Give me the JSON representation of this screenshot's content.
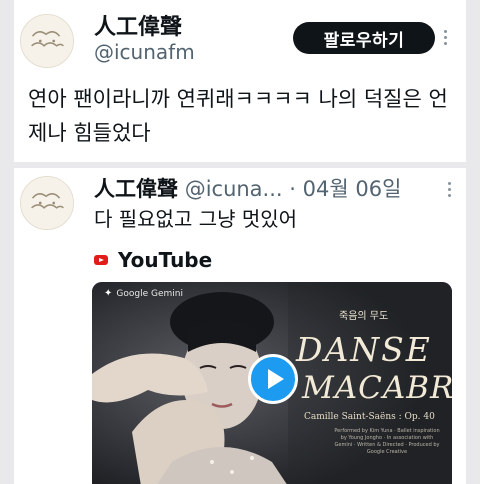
{
  "post": {
    "author_name": "人工偉聲",
    "author_handle": "@icunafm",
    "follow_label": "팔로우하기",
    "more_icon": "more-vertical-icon",
    "text": "연아 팬이라니까 연퀴래ㅋㅋㅋㅋ 나의 덕질은 언제나 힘들었다"
  },
  "quoted": {
    "author_name": "人工偉聲",
    "author_handle": "@icuna...",
    "separator": "·",
    "date": "04월 06일",
    "text": "다 필요없고 그냥 멋있어",
    "link": {
      "source_icon": "youtube-icon",
      "source_label": "YouTube"
    },
    "video": {
      "badge": "Google Gemini",
      "subtitle": "죽음의 무도",
      "title_line1": "DANSE",
      "title_line2": "MACABRE",
      "composer": "Camille Saint-Saëns : Op. 40",
      "credits": "Performed by Kim Yuna · Ballet inspiration by Young Jongho · In association with Gemini · Written & Directed · Produced by Google Creative",
      "play_icon": "play-icon"
    }
  },
  "colors": {
    "follow_bg": "#0f1419",
    "play_accent": "#1d9bf0",
    "youtube_red": "#e21b1b"
  }
}
